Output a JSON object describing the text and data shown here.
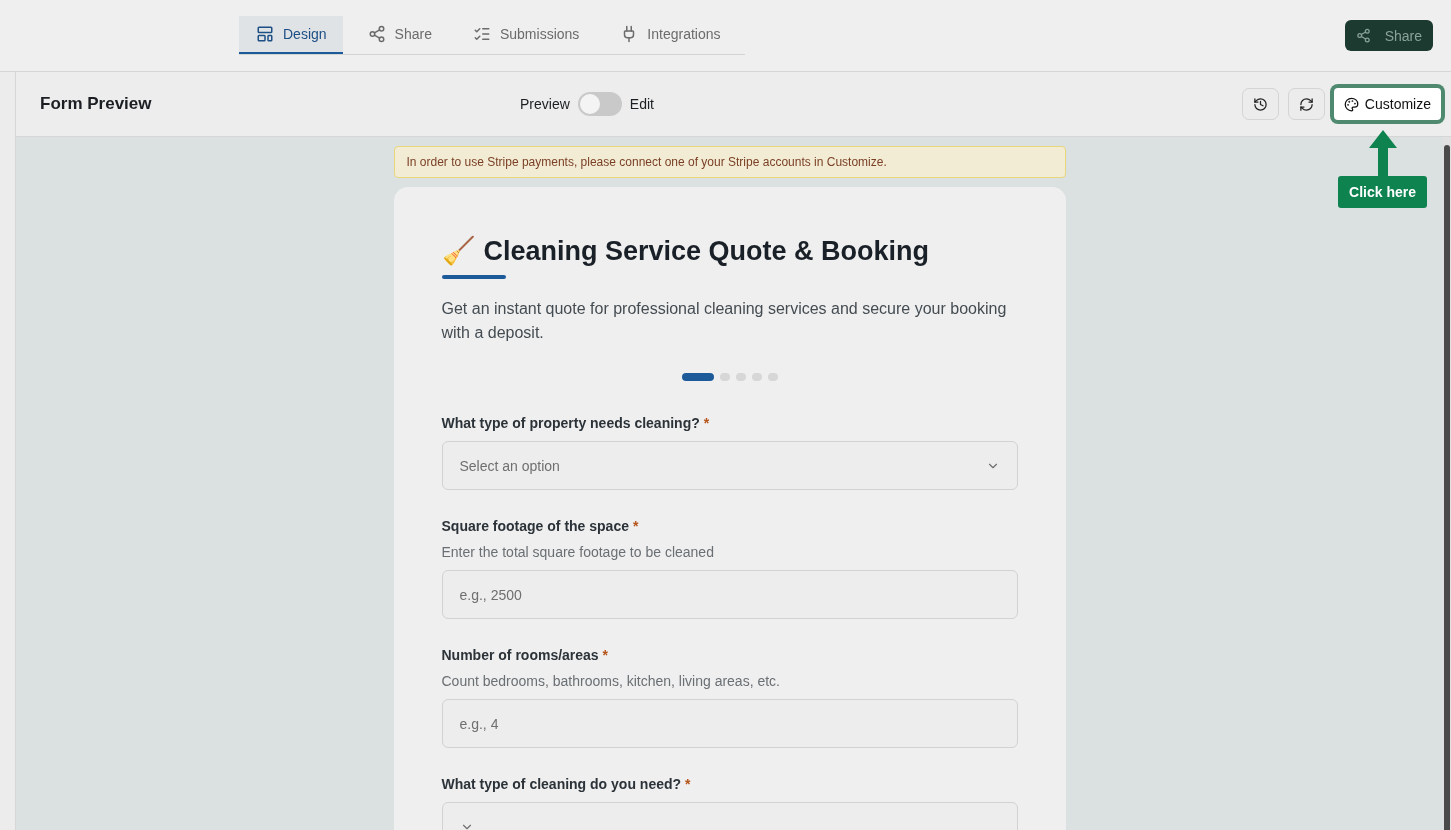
{
  "tabs": [
    {
      "label": "Design",
      "selected": true
    },
    {
      "label": "Share",
      "selected": false
    },
    {
      "label": "Submissions",
      "selected": false
    },
    {
      "label": "Integrations",
      "selected": false
    }
  ],
  "share_button": {
    "label": "Share"
  },
  "toolbar": {
    "title": "Form Preview",
    "toggle": {
      "left_label": "Preview",
      "right_label": "Edit",
      "on": false
    },
    "customize_button": {
      "label": "Customize",
      "highlighted": true
    }
  },
  "tooltip": {
    "text": "Click here"
  },
  "notice": {
    "text": "In order to use Stripe payments, please connect one of your Stripe accounts in Customize."
  },
  "form": {
    "emoji": "🧹",
    "title": "Cleaning Service Quote & Booking",
    "description": "Get an instant quote for professional cleaning services and secure your booking with a deposit.",
    "steps": [
      {
        "selected": true
      },
      {
        "selected": false
      },
      {
        "selected": false
      },
      {
        "selected": false
      },
      {
        "selected": false
      }
    ],
    "fields": [
      {
        "kind": "select",
        "label": "What type of property needs cleaning?",
        "required_mark": "*",
        "placeholder": "Select an option"
      },
      {
        "kind": "input",
        "label": "Square footage of the space",
        "required_mark": "*",
        "help": "Enter the total square footage to be cleaned",
        "placeholder": "e.g., 2500"
      },
      {
        "kind": "input",
        "label": "Number of rooms/areas",
        "required_mark": "*",
        "help": "Count bedrooms, bathrooms, kitchen, living areas, etc.",
        "placeholder": "e.g., 4"
      },
      {
        "kind": "select",
        "label": "What type of cleaning do you need?",
        "required_mark": "*"
      }
    ]
  }
}
